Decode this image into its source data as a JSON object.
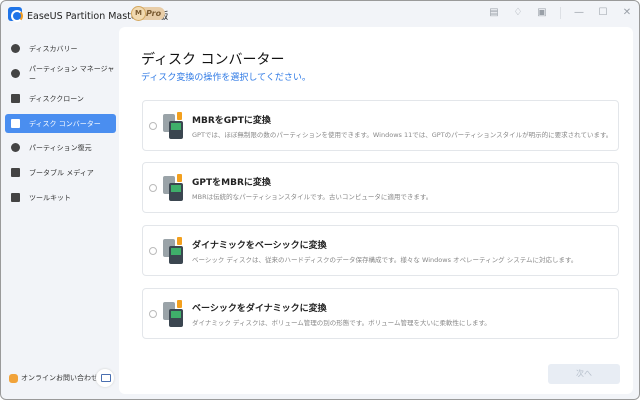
{
  "app": {
    "title": "EaseUS Partition Master Pro版",
    "badge_m": "M",
    "badge": "Pro"
  },
  "titlebar_icons": [
    "notes-icon",
    "bell-icon",
    "feedback-icon",
    "minimize-icon",
    "maximize-icon",
    "close-icon"
  ],
  "titlebar_glyphs": [
    "▤",
    "♢",
    "▣",
    "—",
    "☐",
    "✕"
  ],
  "sidebar": {
    "items": [
      {
        "label": "ディスカバリー",
        "icon": "compass-icon"
      },
      {
        "label": "パーティション マネージャー",
        "icon": "pie-chart-icon"
      },
      {
        "label": "ディスククローン",
        "icon": "disk-clone-icon"
      },
      {
        "label": "ディスク コンバーター",
        "icon": "disk-convert-icon",
        "active": true
      },
      {
        "label": "パーティション復元",
        "icon": "partition-recovery-icon"
      },
      {
        "label": "ブータブル メディア",
        "icon": "bootable-media-icon"
      },
      {
        "label": "ツールキット",
        "icon": "toolkit-icon"
      }
    ],
    "contact": "オンラインお問い合わせ"
  },
  "main": {
    "title": "ディスク コンバーター",
    "subtitle": "ディスク変換の操作を選択してください。",
    "options": [
      {
        "title": "MBRをGPTに変換",
        "desc": "GPTでは、ほぼ無制限の数のパーティションを使用できます。Windows 11では、GPTのパーティションスタイルが明示的に要求されています。"
      },
      {
        "title": "GPTをMBRに変換",
        "desc": "MBRは伝統的なパーティションスタイルです。古いコンピュータに適用できます。"
      },
      {
        "title": "ダイナミックをベーシックに変換",
        "desc": "ベーシック ディスクは、従来のハードディスクのデータ保存構成です。様々な Windows オペレーティング システムに対応します。"
      },
      {
        "title": "ベーシックをダイナミックに変換",
        "desc": "ダイナミック ディスクは、ボリューム管理の別の形態です。ボリューム管理を大いに柔軟性にします。"
      }
    ],
    "next": "次へ"
  },
  "colors": {
    "accent": "#4a8ef0",
    "link": "#2f7ae5"
  }
}
